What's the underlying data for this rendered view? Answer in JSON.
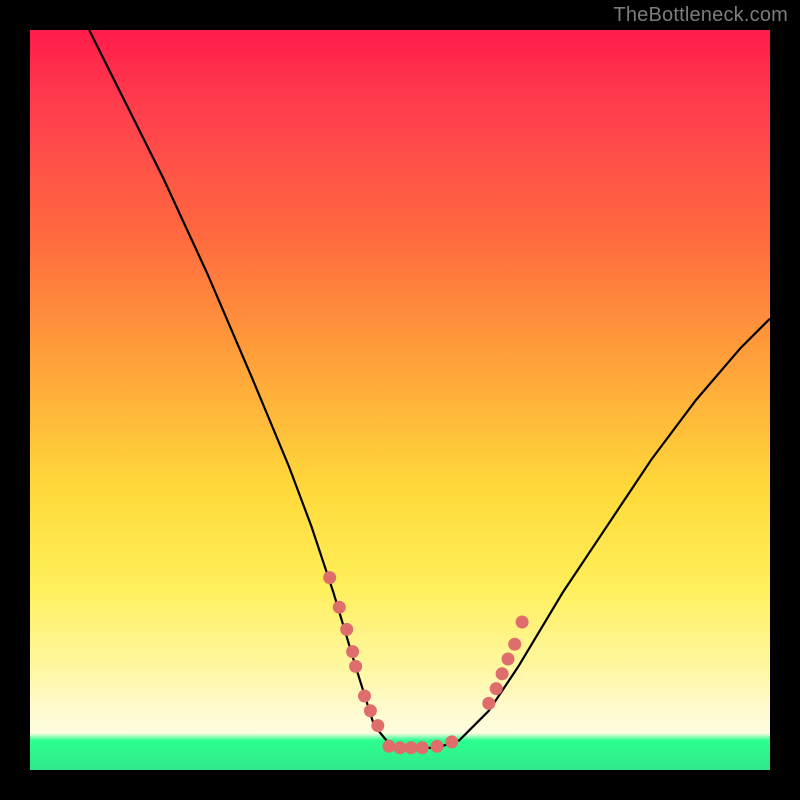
{
  "watermark": "TheBottleneck.com",
  "colors": {
    "frame": "#000000",
    "gradient_top": "#ff1c4b",
    "gradient_mid1": "#ffa23a",
    "gradient_mid2": "#ffef5a",
    "gradient_bottom_band": "#fffde0",
    "gradient_green": "#2cff8f",
    "curve": "#000000",
    "dots": "#de6d6b"
  },
  "chart_data": {
    "type": "line",
    "title": "",
    "xlabel": "",
    "ylabel": "",
    "xlim": [
      0,
      100
    ],
    "ylim": [
      0,
      100
    ],
    "note": "Axes are unlabeled; values are fractions of the plot box (0 = left/bottom, 100 = right/top). The black curve is a V-shape with a flat bottom near y≈3; pink dots cluster along the lower flanks.",
    "series": [
      {
        "name": "bottleneck-curve",
        "x": [
          8,
          12,
          18,
          24,
          30,
          35,
          38,
          41,
          44,
          46.5,
          49,
          52,
          55,
          58,
          62,
          66,
          72,
          78,
          84,
          90,
          96,
          100
        ],
        "y": [
          100,
          92,
          80,
          67,
          53,
          41,
          33,
          24,
          14,
          6,
          3,
          3,
          3,
          4,
          8,
          14,
          24,
          33,
          42,
          50,
          57,
          61
        ]
      }
    ],
    "points": [
      {
        "name": "left-flank-dots",
        "x": [
          40.5,
          41.8,
          42.8,
          43.6,
          44.0,
          45.2,
          46.0,
          47.0
        ],
        "y": [
          26,
          22,
          19,
          16,
          14,
          10,
          8,
          6
        ]
      },
      {
        "name": "bottom-dots",
        "x": [
          48.5,
          50.0,
          51.5,
          53.0,
          55.0,
          57.0
        ],
        "y": [
          3.2,
          3,
          3,
          3,
          3.2,
          3.8
        ]
      },
      {
        "name": "right-flank-dots",
        "x": [
          62.0,
          63.0,
          63.8,
          64.6,
          65.5,
          66.5
        ],
        "y": [
          9,
          11,
          13,
          15,
          17,
          20
        ]
      }
    ]
  }
}
